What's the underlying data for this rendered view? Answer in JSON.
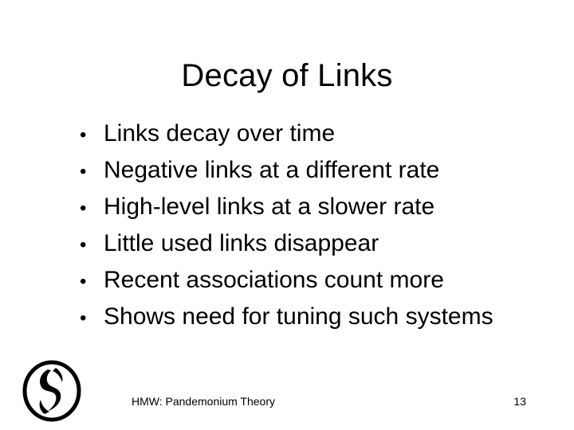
{
  "slide": {
    "title": "Decay of Links",
    "bullets": [
      "Links decay over time",
      "Negative links at a different rate",
      "High-level links at a slower rate",
      "Little used links disappear",
      "Recent associations count more",
      "Shows need for tuning such systems"
    ],
    "bullet_symbol": "•",
    "footer": "HMW: Pandemonium Theory",
    "page_number": "13",
    "logo_icon": "swirl-logo-icon"
  },
  "colors": {
    "text": "#000000",
    "background": "#ffffff"
  }
}
